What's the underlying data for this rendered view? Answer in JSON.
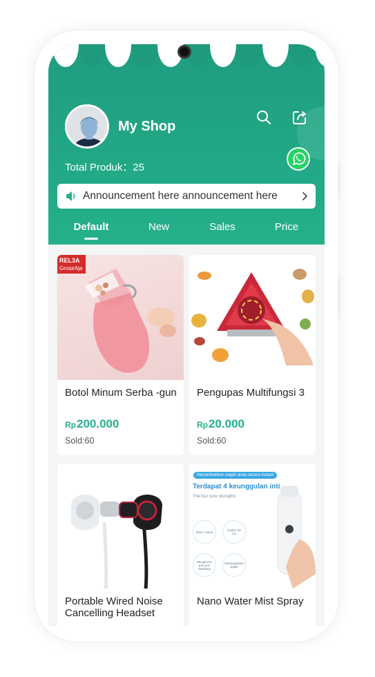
{
  "shop": {
    "name": "My Shop",
    "total_products": "Total Produk：25"
  },
  "header_icons": {
    "search": "search-icon",
    "share": "share-icon",
    "whatsapp": "whatsapp-icon"
  },
  "announcement": {
    "icon": "speaker-icon",
    "text": "Announcement here announcement here",
    "chevron": "chevron-right-icon"
  },
  "tabs": [
    {
      "label": "Default",
      "active": true
    },
    {
      "label": "New",
      "active": false
    },
    {
      "label": "Sales",
      "active": false
    },
    {
      "label": "Price",
      "active": false
    }
  ],
  "products": [
    {
      "name": "Botol Minum Serba -gun",
      "currency": "Rp",
      "price": "200.000",
      "sold": "Sold:60",
      "badge_line1": "REL3A",
      "badge_line2": "GrosirAja"
    },
    {
      "name": "Pengupas Multifungsi 3",
      "currency": "Rp",
      "price": "20.000",
      "sold": "Sold:60"
    },
    {
      "name": "Portable Wired Noise Cancelling Headset"
    },
    {
      "name": "Nano Water Mist Spray",
      "image_text": {
        "pill": "Menambahkan wajah anda secara instant",
        "heading": "Terdapat 4 keunggulan inti",
        "sub": "The four core strengths",
        "b1": "80ml / menit",
        "b2": "Diukur 20 cm",
        "b3": "Mengisi ke pori pori detailnya",
        "b4": "Menyegarkan wajah"
      }
    }
  ],
  "colors": {
    "brand_green": "#24b08b",
    "header_dark": "#1f9c80",
    "badge_red": "#d42b2b",
    "whatsapp_green": "#25d366"
  }
}
